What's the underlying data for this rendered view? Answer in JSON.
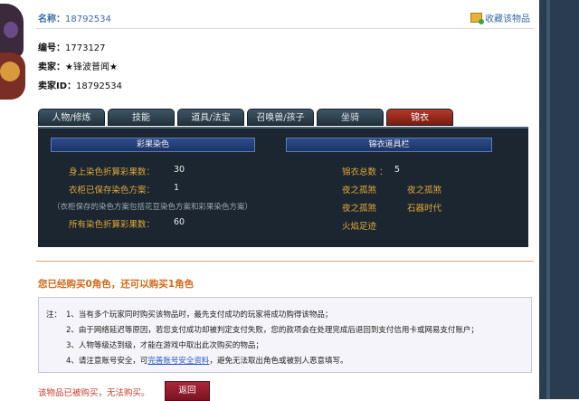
{
  "item": {
    "name_label": "名称：",
    "name_value": "18792534",
    "favorite_label": "收藏该物品",
    "id_label": "编号：",
    "id_value": "1773127",
    "seller_label": "卖家：",
    "seller_value": "★锋波普闻★",
    "seller_id_label": "卖家ID：",
    "seller_id_value": "18792534"
  },
  "tabs": [
    "人物/修炼",
    "技能",
    "道具/法宝",
    "召唤兽/孩子",
    "坐骑",
    "锦衣"
  ],
  "panel": {
    "left_header": "彩果染色",
    "right_header": "锦衣道具栏",
    "left_rows": [
      {
        "label": "身上染色折算彩果数：",
        "value": "30"
      },
      {
        "label": "衣柜已保存染色方案：",
        "value": "1"
      }
    ],
    "left_note": "（衣柜保存的染色方案包括花豆染色方案和彩果染色方案）",
    "left_total": {
      "label": "所有染色折算彩果数：",
      "value": "60"
    },
    "right_total_label": "锦衣总数 ：",
    "right_total_value": "5",
    "right_items": [
      "夜之孤煞",
      "夜之孤煞",
      "夜之孤煞",
      "石器时代",
      "火焰足迹"
    ]
  },
  "buy_message": "您已经购买0角色，还可以购买1角色",
  "notes": {
    "prefix": "注：",
    "line1": "1、当有多个玩家同时购买该物品时，最先支付成功的玩家将成功购得该物品；",
    "line2": "2、由于网络延迟等原因，若您支付成功却被判定支付失败，您的款项会在处理完成后退回到支付信用卡或网易支付账户；",
    "line3": "3、人物等级达到级，才能在游戏中取出此次购买的物品；",
    "line4_pre": "4、请注意账号安全，可",
    "line4_link": "完善账号安全资料",
    "line4_post": "，避免无法取出角色或被别人恶意填写。"
  },
  "bottom": {
    "status": "该物品已被购买，无法购买。",
    "back_label": "返回"
  },
  "colors": {
    "accent_blue": "#3a6aa8",
    "panel_bg": "#1b2630",
    "orange_text": "#e0a63a",
    "active_tab": "#b23a2a"
  }
}
